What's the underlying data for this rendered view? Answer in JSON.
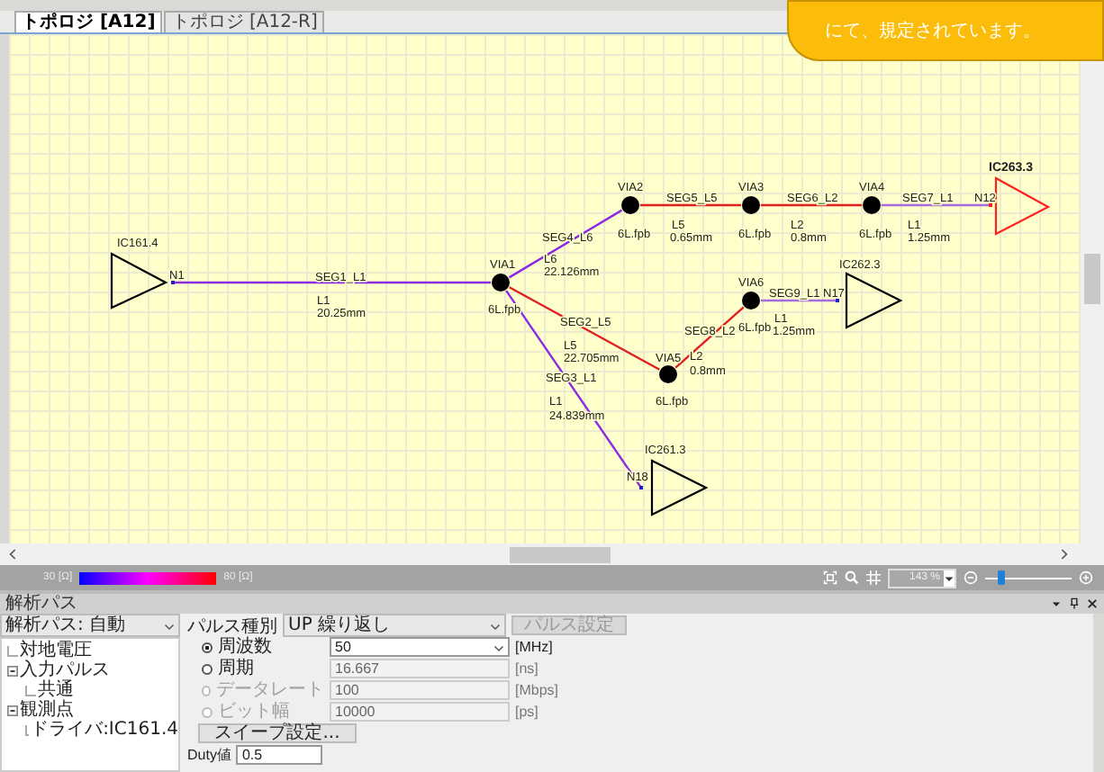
{
  "callout": {
    "text": "にて、規定されています。"
  },
  "tabs": [
    {
      "label": "トポロジ [A12]",
      "selected": true
    },
    {
      "label": "トポロジ [A12-R]",
      "selected": false
    }
  ],
  "diagram": {
    "components": [
      {
        "label": "IC263.3",
        "pin": "N12",
        "color": "#ff2020"
      },
      {
        "label": "IC161.4",
        "pin": "N1",
        "color": "#000000"
      },
      {
        "label": "IC262.3",
        "pin": "N17",
        "color": "#000000"
      },
      {
        "label": "IC261.3",
        "pin": "N18",
        "color": "#000000"
      }
    ],
    "vias": [
      {
        "label": "VIA2",
        "type": "6L.fpb"
      },
      {
        "label": "VIA3",
        "type": "6L.fpb"
      },
      {
        "label": "VIA4",
        "type": "6L.fpb"
      },
      {
        "label": "VIA1",
        "type": "6L.fpb"
      },
      {
        "label": "VIA6",
        "type": "6L.fpb"
      },
      {
        "label": "VIA5",
        "type": "6L.fpb"
      }
    ],
    "segments": [
      {
        "name": "SEG5_L5",
        "layer": "L5",
        "length": "0.65mm",
        "color": "#e02020"
      },
      {
        "name": "SEG6_L2",
        "layer": "L2",
        "length": "0.8mm",
        "color": "#e02020"
      },
      {
        "name": "SEG7_L1",
        "layer": "L1",
        "length": "1.25mm",
        "color": "#a66be2"
      },
      {
        "name": "SEG4_L6",
        "layer": "L6",
        "length": "22.126mm",
        "color": "#8a2be2"
      },
      {
        "name": "SEG1_L1",
        "layer": "L1",
        "length": "20.25mm",
        "color": "#8a2be2"
      },
      {
        "name": "SEG9_L1",
        "layer": "L1",
        "length": "1.25mm",
        "color": "#a66be2"
      },
      {
        "name": "SEG2_L5",
        "layer": "L5",
        "length": "22.705mm",
        "color": "#e02020"
      },
      {
        "name": "SEG8_L2",
        "layer": "L2",
        "length": "0.8mm",
        "color": "#e02020"
      },
      {
        "name": "SEG3_L1",
        "layer": "L1",
        "length": "24.839mm",
        "color": "#8a2be2"
      }
    ]
  },
  "status_bar": {
    "legend_min": "30 [Ω]",
    "legend_max": "80 [Ω]",
    "zoom": "143 %",
    "zoom_slider": {
      "level": 0.18
    }
  },
  "panel": {
    "title": "解析パス",
    "path_select": "解析パス: 自動",
    "tree": [
      {
        "label": "対地電圧"
      },
      {
        "label": "入力パルス",
        "expanded": true,
        "children": [
          {
            "label": "共通"
          }
        ]
      },
      {
        "label": "観測点",
        "expanded": true,
        "children": [
          {
            "label": "ドライバ:IC161.4"
          }
        ]
      }
    ],
    "pulse_type_label": "パルス種別",
    "pulse_type": "UP 繰り返し",
    "pulse_button": {
      "label": "パルス設定",
      "disabled": true
    },
    "params": [
      {
        "kind": "combo",
        "label": "周波数",
        "value": "50",
        "unit": "[MHz]",
        "selected": true,
        "disabled": false
      },
      {
        "kind": "text",
        "label": "周期",
        "value": "16.667",
        "unit": "[ns]",
        "selected": false,
        "disabled": false
      },
      {
        "kind": "text",
        "label": "データレート",
        "value": "100",
        "unit": "[Mbps]",
        "selected": false,
        "disabled": true
      },
      {
        "kind": "text",
        "label": "ビット幅",
        "value": "10000",
        "unit": "[ps]",
        "selected": false,
        "disabled": true
      }
    ],
    "sweep_button": "スイープ設定...",
    "duty_label": "Duty値",
    "duty_value": "0.5"
  }
}
